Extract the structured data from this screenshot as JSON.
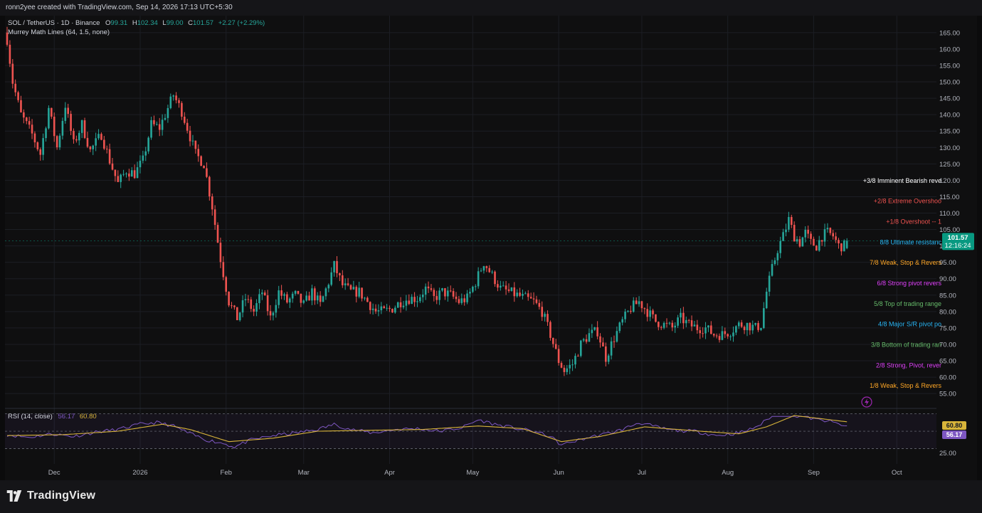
{
  "header": {
    "text": "ronn2yee created with TradingView.com, Sep 14, 2026 17:13 UTC+5:30"
  },
  "legend": {
    "symbol": "SOL / TetherUS · 1D · Binance",
    "o_label": "O",
    "o_value": "99.31",
    "h_label": "H",
    "h_value": "102.34",
    "l_label": "L",
    "l_value": "99.00",
    "c_label": "C",
    "c_value": "101.57",
    "change": "+2.27 (+2.29%)",
    "indicator": "Murrey Math Lines (64, 1.5, none)"
  },
  "rsi_legend": {
    "label": "RSI (14, close)",
    "value1": "56.17",
    "value2": "60.80"
  },
  "price_badge": {
    "price": "101.57",
    "countdown": "12:16:24"
  },
  "rsi_badges": {
    "ma": "60.80",
    "rsi": "56.17"
  },
  "brand": {
    "name": "TradingView",
    "logo_icon": "tradingview-logo-icon"
  },
  "colors": {
    "up": "#26a69a",
    "down": "#ef5350",
    "rsi_line": "#7e57c2",
    "rsi_ma": "#d8b43a",
    "badge_green": "#089981",
    "badge_purple": "#7e57c2"
  },
  "chart_data": [
    {
      "type": "candlestick",
      "symbol": "SOL / TetherUS",
      "interval": "1D",
      "exchange": "Binance",
      "ylim": [
        52,
        168
      ],
      "y_ticks": [
        "165.00",
        "160.00",
        "155.00",
        "150.00",
        "145.00",
        "140.00",
        "135.00",
        "130.00",
        "125.00",
        "120.00",
        "115.00",
        "110.00",
        "105.00",
        "100.00",
        "95.00",
        "90.00",
        "85.00",
        "80.00",
        "75.00",
        "70.00",
        "65.00",
        "60.00",
        "55.00"
      ],
      "x_ticks": [
        {
          "label": "Dec",
          "day": 17
        },
        {
          "label": "2026",
          "day": 48
        },
        {
          "label": "Feb",
          "day": 79
        },
        {
          "label": "Mar",
          "day": 107
        },
        {
          "label": "Apr",
          "day": 138
        },
        {
          "label": "May",
          "day": 168
        },
        {
          "label": "Jun",
          "day": 199
        },
        {
          "label": "Jul",
          "day": 229
        },
        {
          "label": "Aug",
          "day": 260
        },
        {
          "label": "Sep",
          "day": 291
        },
        {
          "label": "Oct",
          "day": 321
        }
      ],
      "last_day": 303,
      "anchors": [
        [
          0,
          163
        ],
        [
          2,
          150
        ],
        [
          5,
          140
        ],
        [
          9,
          134
        ],
        [
          12,
          128
        ],
        [
          15,
          142
        ],
        [
          18,
          130
        ],
        [
          21,
          143
        ],
        [
          24,
          131
        ],
        [
          27,
          137
        ],
        [
          30,
          129
        ],
        [
          34,
          134
        ],
        [
          37,
          126
        ],
        [
          40,
          119
        ],
        [
          43,
          123
        ],
        [
          46,
          122
        ],
        [
          49,
          126
        ],
        [
          52,
          137
        ],
        [
          55,
          136
        ],
        [
          58,
          142
        ],
        [
          60,
          146
        ],
        [
          63,
          141
        ],
        [
          65,
          136
        ],
        [
          68,
          128
        ],
        [
          71,
          125
        ],
        [
          74,
          112
        ],
        [
          77,
          96
        ],
        [
          80,
          83
        ],
        [
          83,
          78
        ],
        [
          86,
          84
        ],
        [
          89,
          80
        ],
        [
          92,
          86
        ],
        [
          95,
          78
        ],
        [
          98,
          86
        ],
        [
          101,
          83
        ],
        [
          104,
          85
        ],
        [
          107,
          82
        ],
        [
          110,
          86
        ],
        [
          113,
          82
        ],
        [
          116,
          89
        ],
        [
          118,
          94
        ],
        [
          121,
          88
        ],
        [
          124,
          86
        ],
        [
          127,
          86
        ],
        [
          130,
          83
        ],
        [
          133,
          80
        ],
        [
          136,
          80
        ],
        [
          139,
          81
        ],
        [
          142,
          83
        ],
        [
          145,
          84
        ],
        [
          148,
          84
        ],
        [
          151,
          87
        ],
        [
          154,
          84
        ],
        [
          157,
          86
        ],
        [
          160,
          85
        ],
        [
          163,
          83
        ],
        [
          166,
          84
        ],
        [
          169,
          89
        ],
        [
          172,
          95
        ],
        [
          175,
          91
        ],
        [
          178,
          87
        ],
        [
          181,
          86
        ],
        [
          184,
          85
        ],
        [
          187,
          84
        ],
        [
          190,
          83
        ],
        [
          193,
          80
        ],
        [
          196,
          73
        ],
        [
          199,
          65
        ],
        [
          201,
          62
        ],
        [
          204,
          64
        ],
        [
          207,
          70
        ],
        [
          210,
          73
        ],
        [
          213,
          74
        ],
        [
          216,
          66
        ],
        [
          219,
          72
        ],
        [
          222,
          77
        ],
        [
          225,
          81
        ],
        [
          228,
          83
        ],
        [
          231,
          80
        ],
        [
          234,
          77
        ],
        [
          237,
          76
        ],
        [
          240,
          75
        ],
        [
          243,
          78
        ],
        [
          246,
          76
        ],
        [
          249,
          75
        ],
        [
          252,
          75
        ],
        [
          255,
          73
        ],
        [
          258,
          73
        ],
        [
          261,
          74
        ],
        [
          264,
          76
        ],
        [
          267,
          76
        ],
        [
          270,
          75
        ],
        [
          272,
          76
        ],
        [
          274,
          86
        ],
        [
          276,
          93
        ],
        [
          278,
          99
        ],
        [
          280,
          103
        ],
        [
          282,
          108
        ],
        [
          284,
          103
        ],
        [
          286,
          101
        ],
        [
          288,
          104
        ],
        [
          290,
          101
        ],
        [
          292,
          100
        ],
        [
          294,
          103
        ],
        [
          296,
          104
        ],
        [
          298,
          103
        ],
        [
          300,
          100
        ],
        [
          302,
          100
        ],
        [
          303,
          101.57
        ]
      ],
      "murrey_levels": [
        {
          "label": "+3/8 Imminent Bearish reve",
          "price": 120.0,
          "color": "#ffffff"
        },
        {
          "label": "+2/8 Extreme Overshoo",
          "price": 113.75,
          "color": "#ef5350"
        },
        {
          "label": "+1/8 Overshoot --  1",
          "price": 107.5,
          "color": "#ef5350"
        },
        {
          "label": "8/8 Ultimate resistanc",
          "price": 101.25,
          "color": "#29b6f6"
        },
        {
          "label": "7/8 Weak, Stop & Revers",
          "price": 95.0,
          "color": "#ffa726"
        },
        {
          "label": "6/8 Strong pivot revers",
          "price": 88.75,
          "color": "#e040fb"
        },
        {
          "label": "5/8 Top of trading range",
          "price": 82.5,
          "color": "#66bb6a"
        },
        {
          "label": "4/8 Major S/R pivot po",
          "price": 76.25,
          "color": "#29b6f6"
        },
        {
          "label": "3/8 Bottom of trading ran",
          "price": 70.0,
          "color": "#66bb6a"
        },
        {
          "label": "2/8 Strong, Pivot, rever",
          "price": 63.75,
          "color": "#e040fb"
        },
        {
          "label": "1/8 Weak, Stop & Revers",
          "price": 57.5,
          "color": "#ffa726"
        }
      ]
    },
    {
      "type": "line",
      "name": "RSI (14, close)",
      "ylim": [
        19,
        68
      ],
      "y_ticks": [
        "25.00"
      ],
      "bands": [
        30,
        50,
        70
      ],
      "rsi_anchors": [
        [
          0,
          46
        ],
        [
          8,
          43
        ],
        [
          16,
          47
        ],
        [
          24,
          44
        ],
        [
          32,
          49
        ],
        [
          40,
          52
        ],
        [
          48,
          58
        ],
        [
          54,
          60
        ],
        [
          60,
          56
        ],
        [
          66,
          47
        ],
        [
          72,
          40
        ],
        [
          78,
          36
        ],
        [
          82,
          32
        ],
        [
          88,
          40
        ],
        [
          96,
          45
        ],
        [
          104,
          48
        ],
        [
          112,
          52
        ],
        [
          118,
          58
        ],
        [
          124,
          52
        ],
        [
          132,
          48
        ],
        [
          140,
          52
        ],
        [
          148,
          53
        ],
        [
          156,
          50
        ],
        [
          164,
          54
        ],
        [
          170,
          63
        ],
        [
          176,
          58
        ],
        [
          184,
          53
        ],
        [
          190,
          50
        ],
        [
          196,
          44
        ],
        [
          200,
          34
        ],
        [
          204,
          38
        ],
        [
          210,
          43
        ],
        [
          216,
          47
        ],
        [
          222,
          52
        ],
        [
          228,
          60
        ],
        [
          234,
          55
        ],
        [
          240,
          51
        ],
        [
          248,
          50
        ],
        [
          256,
          45
        ],
        [
          264,
          48
        ],
        [
          268,
          52
        ],
        [
          272,
          58
        ],
        [
          276,
          68
        ],
        [
          280,
          72
        ],
        [
          284,
          68
        ],
        [
          288,
          67
        ],
        [
          292,
          63
        ],
        [
          296,
          62
        ],
        [
          300,
          58
        ],
        [
          303,
          56.17
        ]
      ],
      "ma_anchors": [
        [
          0,
          45
        ],
        [
          20,
          46
        ],
        [
          40,
          50
        ],
        [
          56,
          58
        ],
        [
          66,
          52
        ],
        [
          80,
          38
        ],
        [
          96,
          42
        ],
        [
          112,
          50
        ],
        [
          130,
          51
        ],
        [
          150,
          52
        ],
        [
          170,
          56
        ],
        [
          186,
          53
        ],
        [
          200,
          38
        ],
        [
          214,
          44
        ],
        [
          230,
          55
        ],
        [
          250,
          50
        ],
        [
          264,
          47
        ],
        [
          274,
          55
        ],
        [
          284,
          68
        ],
        [
          292,
          65
        ],
        [
          303,
          60.8
        ]
      ]
    }
  ]
}
